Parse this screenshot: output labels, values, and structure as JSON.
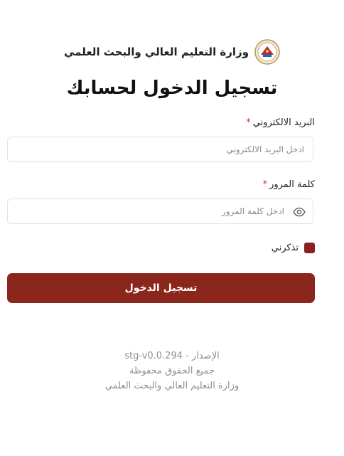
{
  "header": {
    "org_name": "وزارة التعليم العالي والبحث العلمي",
    "logo_icon": "ministry-seal-icon"
  },
  "page_title": "تسجيل الدخول لحسابك",
  "form": {
    "email": {
      "label": "البريد الالكتروني",
      "required_mark": "*",
      "placeholder": "ادخل البريد الالكتروني",
      "value": ""
    },
    "password": {
      "label": "كلمة المرور",
      "required_mark": "*",
      "placeholder": "ادخل كلمة المرور",
      "value": "",
      "toggle_icon": "eye-icon"
    },
    "remember_me": {
      "label": "تذكرني",
      "checked": true
    },
    "submit_label": "تسجيل الدخول"
  },
  "footer": {
    "version": "الإصدار - stg-v0.0.294",
    "rights": "جميع الحقوق محفوظة",
    "org": "وزارة التعليم العالي والبحث العلمي"
  },
  "colors": {
    "primary": "#8b261c",
    "required": "#c0392b",
    "muted_text": "#8f8f8f"
  }
}
